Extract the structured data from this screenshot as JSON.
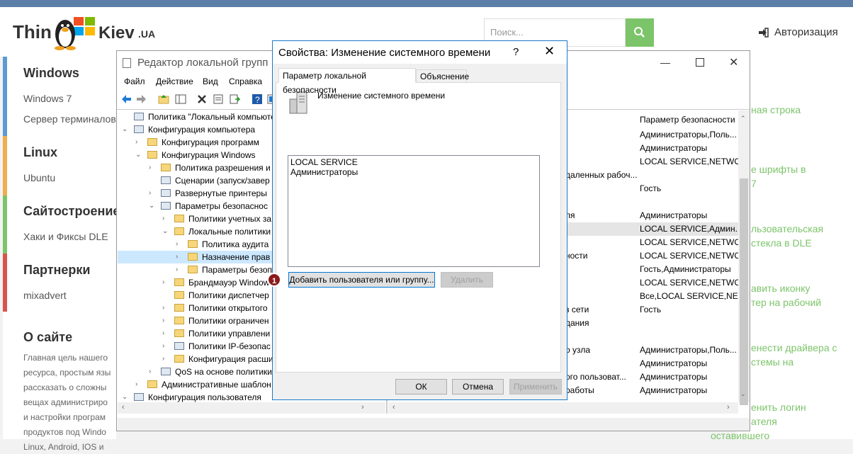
{
  "site": {
    "logo_thin": "Thin",
    "logo_kiev": "Kiev",
    "logo_ua": ".UA",
    "search_placeholder": "Поиск...",
    "auth_label": "Авторизация",
    "sections": [
      {
        "title": "Windows",
        "color": "#5b9bd5",
        "items": [
          "Windows 7",
          "Сервер терминалов"
        ]
      },
      {
        "title": "Linux",
        "color": "#f0ad4e",
        "items": [
          "Ubuntu"
        ]
      },
      {
        "title": "Сайтостроение",
        "color": "#7cc46a",
        "items": [
          "Хаки и Фиксы DLE"
        ]
      },
      {
        "title": "Партнерки",
        "color": "#d9534f",
        "items": [
          "mixadvert"
        ]
      }
    ],
    "about_title": "О сайте",
    "about_lines": [
      "Главная цель нашего",
      "ресурса, простым язы",
      "рассказать о сложны",
      "вещах администриро",
      "и настройки програм",
      "продуктов под Windo",
      "Linux, Android, IOS и"
    ],
    "right_links": [
      [
        "ная строка"
      ],
      [
        "е шрифты в",
        "7"
      ],
      [
        "льзовательская",
        "стекла в DLE"
      ],
      [
        "авить иконку",
        "тер на рабочий"
      ],
      [
        "енести драйвера с",
        "стемы на"
      ],
      [
        "енить логин",
        "ателя",
        "оставившего"
      ]
    ],
    "accent": "#7cc46a"
  },
  "gpedit": {
    "title": "Редактор локальной групп",
    "menu": [
      "Файл",
      "Действие",
      "Вид",
      "Справка"
    ],
    "tree": [
      {
        "label": "Политика \"Локальный компьютер\"",
        "level": 0,
        "arrow": "",
        "icon": "policy"
      },
      {
        "label": "Конфигурация компьютера",
        "level": 0,
        "arrow": "⌄",
        "icon": "computer"
      },
      {
        "label": "Конфигурация программ",
        "level": 1,
        "arrow": "›",
        "icon": "folder"
      },
      {
        "label": "Конфигурация Windows",
        "level": 1,
        "arrow": "⌄",
        "icon": "folder"
      },
      {
        "label": "Политика разрешения и",
        "level": 2,
        "arrow": "›",
        "icon": "folder"
      },
      {
        "label": "Сценарии (запуск/завер",
        "level": 2,
        "arrow": "",
        "icon": "script"
      },
      {
        "label": "Развернутые принтеры",
        "level": 2,
        "arrow": "›",
        "icon": "printer"
      },
      {
        "label": "Параметры безопаснос",
        "level": 2,
        "arrow": "⌄",
        "icon": "security"
      },
      {
        "label": "Политики учетных за",
        "level": 3,
        "arrow": "›",
        "icon": "folder"
      },
      {
        "label": "Локальные политики",
        "level": 3,
        "arrow": "⌄",
        "icon": "folder"
      },
      {
        "label": "Политика аудита",
        "level": 4,
        "arrow": "›",
        "icon": "folder"
      },
      {
        "label": "Назначение прав",
        "level": 4,
        "arrow": "›",
        "icon": "folder",
        "selected": true
      },
      {
        "label": "Параметры безоп",
        "level": 4,
        "arrow": "›",
        "icon": "folder"
      },
      {
        "label": "Брандмауэр Window",
        "level": 3,
        "arrow": "›",
        "icon": "folder"
      },
      {
        "label": "Политики диспетчер",
        "level": 3,
        "arrow": "",
        "icon": "folder"
      },
      {
        "label": "Политики открытого",
        "level": 3,
        "arrow": "›",
        "icon": "folder"
      },
      {
        "label": "Политики ограничен",
        "level": 3,
        "arrow": "›",
        "icon": "folder"
      },
      {
        "label": "Политики управлени",
        "level": 3,
        "arrow": "›",
        "icon": "folder"
      },
      {
        "label": "Политики IP-безопас",
        "level": 3,
        "arrow": "›",
        "icon": "ipsec"
      },
      {
        "label": "Конфигурация расши",
        "level": 3,
        "arrow": "›",
        "icon": "folder"
      },
      {
        "label": "QoS на основе политики",
        "level": 2,
        "arrow": "›",
        "icon": "chart"
      },
      {
        "label": "Административные шаблон",
        "level": 1,
        "arrow": "›",
        "icon": "folder"
      },
      {
        "label": "Конфигурация пользователя",
        "level": 0,
        "arrow": "⌄",
        "icon": "user"
      }
    ],
    "list_header": "Параметр безопасности",
    "list_rows": [
      {
        "left": "",
        "right": "Администраторы,Поль..."
      },
      {
        "left": "",
        "right": "Администраторы"
      },
      {
        "left": "",
        "right": "LOCAL SERVICE,NETWO..."
      },
      {
        "left": "даленных рабоч...",
        "right": ""
      },
      {
        "left": "",
        "right": "Гость"
      },
      {
        "left": "",
        "right": ""
      },
      {
        "left": "ля",
        "right": "Администраторы"
      },
      {
        "left": "",
        "right": "LOCAL SERVICE,Админ...",
        "hl": true
      },
      {
        "left": "",
        "right": "LOCAL SERVICE,NETWO..."
      },
      {
        "left": "ности",
        "right": "LOCAL SERVICE,NETWO..."
      },
      {
        "left": "",
        "right": "Гость,Администраторы"
      },
      {
        "left": "",
        "right": "LOCAL SERVICE,NETWO..."
      },
      {
        "left": "",
        "right": "Все,LOCAL SERVICE,NE..."
      },
      {
        "left": "з сети",
        "right": "Гость"
      },
      {
        "left": "дания",
        "right": ""
      },
      {
        "left": "",
        "right": ""
      },
      {
        "left": "о узла",
        "right": "Администраторы,Поль..."
      },
      {
        "left": "",
        "right": "Администраторы"
      },
      {
        "left": "ого пользоват...",
        "right": "Администраторы"
      },
      {
        "left": "работы",
        "right": "Администраторы"
      }
    ]
  },
  "dialog": {
    "title": "Свойства: Изменение системного времени",
    "help": "?",
    "close": "✕",
    "tabs": [
      "Параметр локальной безопасности",
      "Объяснение"
    ],
    "policy_name": "Изменение системного времени",
    "entries": [
      "LOCAL SERVICE",
      "Администраторы"
    ],
    "add_button": "Добавить пользователя или группу...",
    "remove_button": "Удалить",
    "ok_button": "ОК",
    "cancel_button": "Отмена",
    "apply_button": "Применить",
    "badge": "1"
  }
}
